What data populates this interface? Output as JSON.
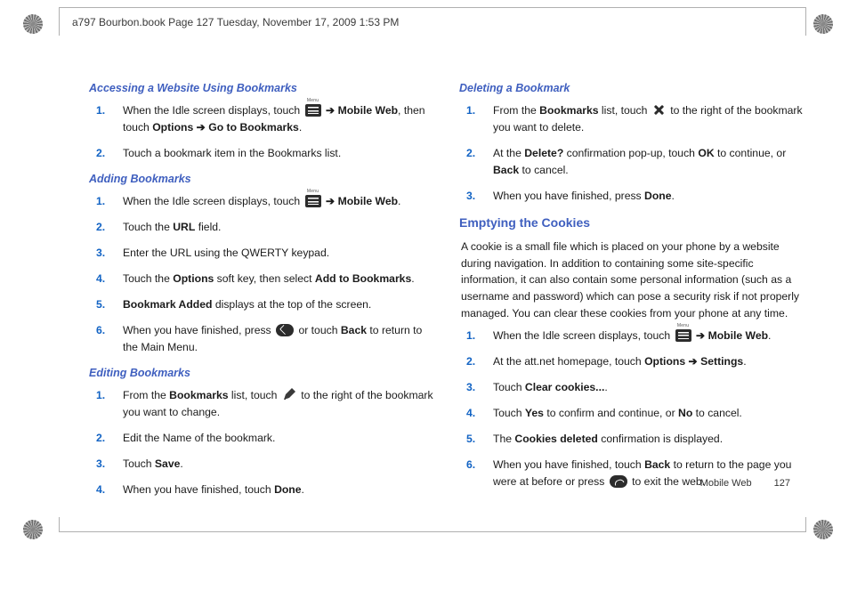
{
  "frame_header": "a797 Bourbon.book  Page 127  Tuesday, November 17, 2009  1:53 PM",
  "footer": {
    "section": "Mobile Web",
    "page": "127"
  },
  "arrow": "➔",
  "accessing": {
    "heading": "Accessing a Website Using Bookmarks",
    "steps": [
      {
        "pre": "When the Idle screen displays, touch ",
        "post1": " Mobile Web",
        "post2": ", then touch ",
        "b1": "Options",
        "mid": " ",
        "b2": "Go to Bookmarks",
        "end": "."
      },
      {
        "text": "Touch a bookmark item in the Bookmarks list."
      }
    ]
  },
  "adding": {
    "heading": "Adding Bookmarks",
    "steps": [
      {
        "pre": "When the Idle screen displays, touch ",
        "post": " Mobile Web",
        "end": "."
      },
      {
        "pre": "Touch the ",
        "b": "URL",
        "post": " field."
      },
      {
        "text": "Enter the URL using the QWERTY keypad."
      },
      {
        "pre": "Touch the ",
        "b1": "Options",
        "mid": " soft key, then select ",
        "b2": "Add to Bookmarks",
        "end": "."
      },
      {
        "b": "Bookmark Added",
        "post": " displays at the top of the screen."
      },
      {
        "pre": "When you have finished, press ",
        "mid": " or touch ",
        "b": "Back",
        "post": " to return to the Main Menu."
      }
    ]
  },
  "editing": {
    "heading": "Editing Bookmarks",
    "steps": [
      {
        "pre": "From the ",
        "b": "Bookmarks",
        "mid": " list, touch ",
        "post": " to the right of the bookmark you want to change."
      },
      {
        "text": "Edit the Name of the bookmark."
      },
      {
        "pre": "Touch ",
        "b": "Save",
        "end": "."
      },
      {
        "pre": "When you have finished, touch ",
        "b": "Done",
        "end": "."
      }
    ]
  },
  "deleting": {
    "heading": "Deleting a Bookmark",
    "steps": [
      {
        "pre": "From the ",
        "b": "Bookmarks",
        "mid": " list, touch ",
        "post": " to the right of the bookmark you want to delete."
      },
      {
        "pre": "At the ",
        "b1": "Delete?",
        "mid": " confirmation pop-up, touch ",
        "b2": "OK",
        "mid2": " to continue, or ",
        "b3": "Back",
        "end": " to cancel."
      },
      {
        "pre": "When you have finished, press ",
        "b": "Done",
        "end": "."
      }
    ]
  },
  "cookies": {
    "heading": "Emptying the Cookies",
    "intro": "A cookie is a small file which is placed on your phone by a website during navigation. In addition to containing some site-specific information, it can also contain some personal information (such as a username and password) which can pose a security risk if not properly managed. You can clear these cookies from your phone at any time.",
    "steps": [
      {
        "pre": "When the Idle screen displays, touch ",
        "post": " Mobile Web",
        "end": "."
      },
      {
        "pre": "At the att.net homepage, touch ",
        "b1": "Options",
        "mid": " ",
        "b2": "Settings",
        "end": "."
      },
      {
        "pre": "Touch ",
        "b": "Clear cookies...",
        "end": "."
      },
      {
        "pre": "Touch ",
        "b1": "Yes",
        "mid": " to confirm and continue, or ",
        "b2": "No",
        "end": " to cancel."
      },
      {
        "pre": "The ",
        "b": "Cookies deleted",
        "post": " confirmation is displayed."
      },
      {
        "pre": "When you have finished, touch ",
        "b": "Back",
        "mid": " to return to the page you were at before or press ",
        "post": " to exit the web."
      }
    ]
  }
}
